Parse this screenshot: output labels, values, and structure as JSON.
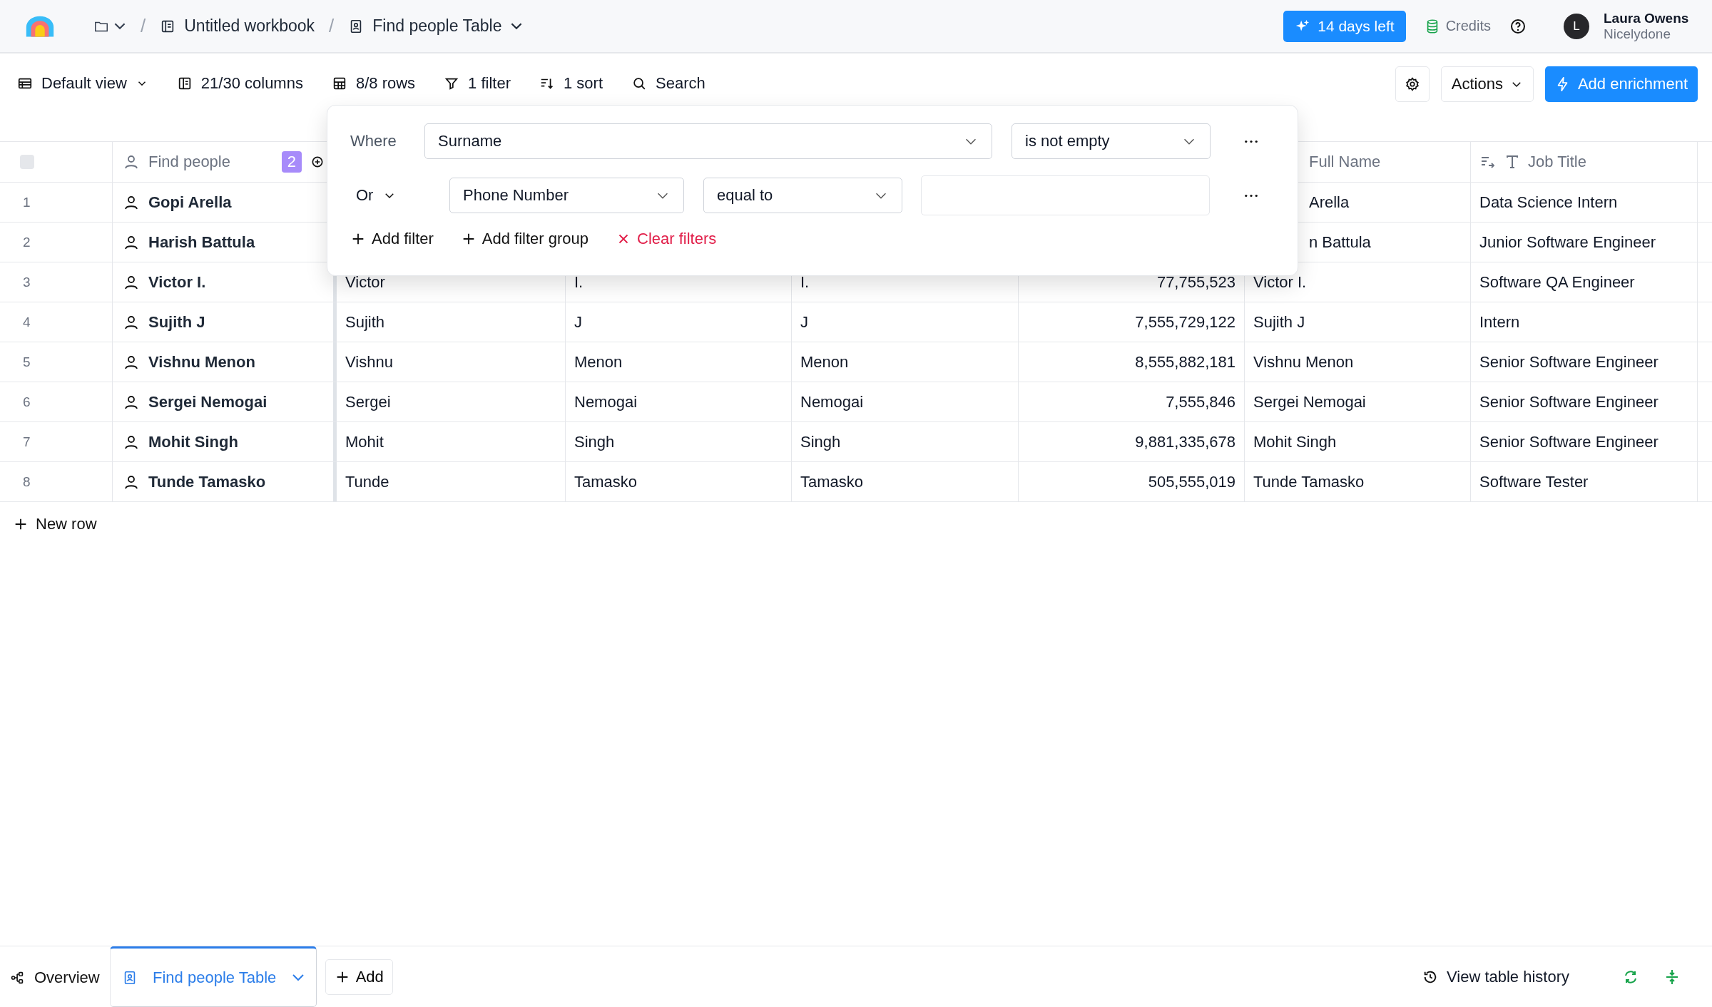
{
  "topbar": {
    "breadcrumb": [
      {
        "kind": "folder",
        "dropdown": true
      },
      {
        "kind": "separator",
        "label": "/"
      },
      {
        "kind": "workbook",
        "label": "Untitled workbook"
      },
      {
        "kind": "separator",
        "label": "/"
      },
      {
        "kind": "table",
        "label": "Find people Table",
        "dropdown": true
      }
    ],
    "trial": "14 days left",
    "credits": "Credits",
    "user": {
      "initial": "L",
      "name": "Laura Owens",
      "org": "Nicelydone"
    }
  },
  "toolbar": {
    "items": [
      {
        "kind": "view",
        "label": "Default view",
        "dropdown": true
      },
      {
        "kind": "columns",
        "label": "21/30 columns"
      },
      {
        "kind": "rows",
        "label": "8/8 rows"
      },
      {
        "kind": "filter",
        "label": "1 filter"
      },
      {
        "kind": "sort",
        "label": "1 sort"
      },
      {
        "kind": "search",
        "label": "Search"
      }
    ],
    "actions": "Actions",
    "enrich": "Add enrichment"
  },
  "filter_popup": {
    "conditions": [
      {
        "kind": "where",
        "label": "Where",
        "field": "Surname",
        "operator": "is not empty"
      },
      {
        "kind": "connector",
        "label": "Or",
        "field": "Phone Number",
        "operator": "equal to"
      }
    ],
    "buttons": [
      {
        "kind": "add",
        "label": "Add filter"
      },
      {
        "kind": "add",
        "label": "Add filter group"
      },
      {
        "kind": "clear",
        "label": "Clear filters"
      }
    ]
  },
  "table": {
    "select_all": {
      "checked": false
    },
    "columns": [
      {
        "label": "Find people",
        "badge": "2",
        "kind": "person"
      },
      null,
      null,
      null,
      null,
      {
        "label": "Full Name",
        "kind": "plain"
      },
      {
        "label": "Job Title",
        "kind": "text"
      }
    ],
    "rows": [
      {
        "number": "1",
        "cells": [
          "Gopi Arella",
          null,
          null,
          null,
          null,
          "Arella",
          "Data Science Intern"
        ]
      },
      {
        "number": "2",
        "cells": [
          "Harish Battula",
          null,
          null,
          null,
          null,
          "n Battula",
          "Junior Software Engineer"
        ]
      },
      {
        "number": "3",
        "cells": [
          "Victor I.",
          "Victor",
          "I.",
          "I.",
          "77,755,523",
          "Victor I.",
          "Software QA Engineer"
        ]
      },
      {
        "number": "4",
        "cells": [
          "Sujith J",
          "Sujith",
          "J",
          "J",
          "7,555,729,122",
          "Sujith J",
          "Intern"
        ]
      },
      {
        "number": "5",
        "cells": [
          "Vishnu Menon",
          "Vishnu",
          "Menon",
          "Menon",
          "8,555,882,181",
          "Vishnu Menon",
          "Senior Software Engineer"
        ]
      },
      {
        "number": "6",
        "cells": [
          "Sergei Nemogai",
          "Sergei",
          "Nemogai",
          "Nemogai",
          "7,555,846",
          "Sergei Nemogai",
          "Senior Software Engineer"
        ]
      },
      {
        "number": "7",
        "cells": [
          "Mohit Singh",
          "Mohit",
          "Singh",
          "Singh",
          "9,881,335,678",
          "Mohit Singh",
          "Senior Software Engineer"
        ]
      },
      {
        "number": "8",
        "cells": [
          "Tunde Tamasko",
          "Tunde",
          "Tamasko",
          "Tamasko",
          "505,555,019",
          "Tunde Tamasko",
          "Software Tester"
        ]
      }
    ],
    "new_row": "New row"
  },
  "bottom_bar": {
    "tabs": [
      {
        "kind": "overview",
        "label": "Overview",
        "selected": false
      },
      {
        "kind": "table",
        "label": "Find people Table",
        "selected": true
      }
    ],
    "add": "Add",
    "history": "View table history"
  }
}
